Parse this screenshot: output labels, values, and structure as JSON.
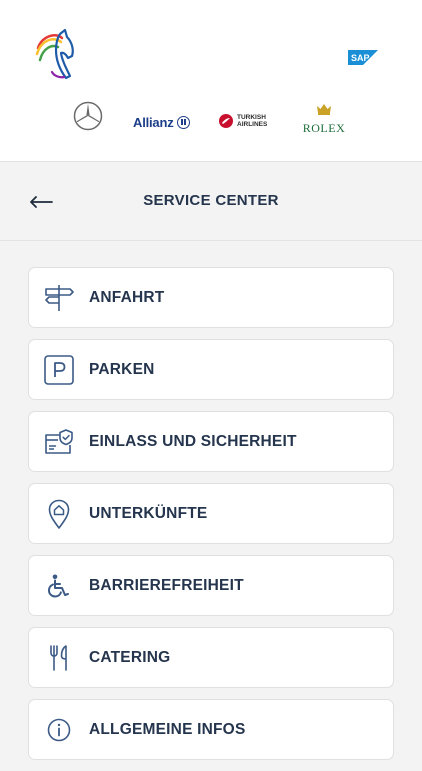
{
  "header": {
    "event_logo_icon": "horse-head-logo-icon",
    "sap_logo_text": "SAP",
    "sponsors": {
      "mercedes_icon": "mercedes-star-icon",
      "allianz": "Allianz",
      "turkish_line1": "TURKISH",
      "turkish_line2": "AIRLINES",
      "rolex": "ROLEX"
    }
  },
  "titlebar": {
    "back_icon": "arrow-left-icon",
    "title": "SERVICE CENTER"
  },
  "menu": {
    "items": [
      {
        "label": "ANFAHRT",
        "icon": "signpost-icon"
      },
      {
        "label": "PARKEN",
        "icon": "parking-icon"
      },
      {
        "label": "EINLASS UND SICHERHEIT",
        "icon": "ticket-shield-icon"
      },
      {
        "label": "UNTERKÜNFTE",
        "icon": "location-home-icon"
      },
      {
        "label": "BARRIEREFREIHEIT",
        "icon": "wheelchair-icon"
      },
      {
        "label": "CATERING",
        "icon": "cutlery-icon"
      },
      {
        "label": "ALLGEMEINE INFOS",
        "icon": "info-icon"
      }
    ]
  },
  "colors": {
    "text": "#25354d",
    "background": "#f3f3f3",
    "card": "#ffffff",
    "sap_blue": "#1a8fd6",
    "rolex_green": "#1f6e3b",
    "allianz_blue": "#1d3f8a",
    "turkish_red": "#c8102e"
  }
}
